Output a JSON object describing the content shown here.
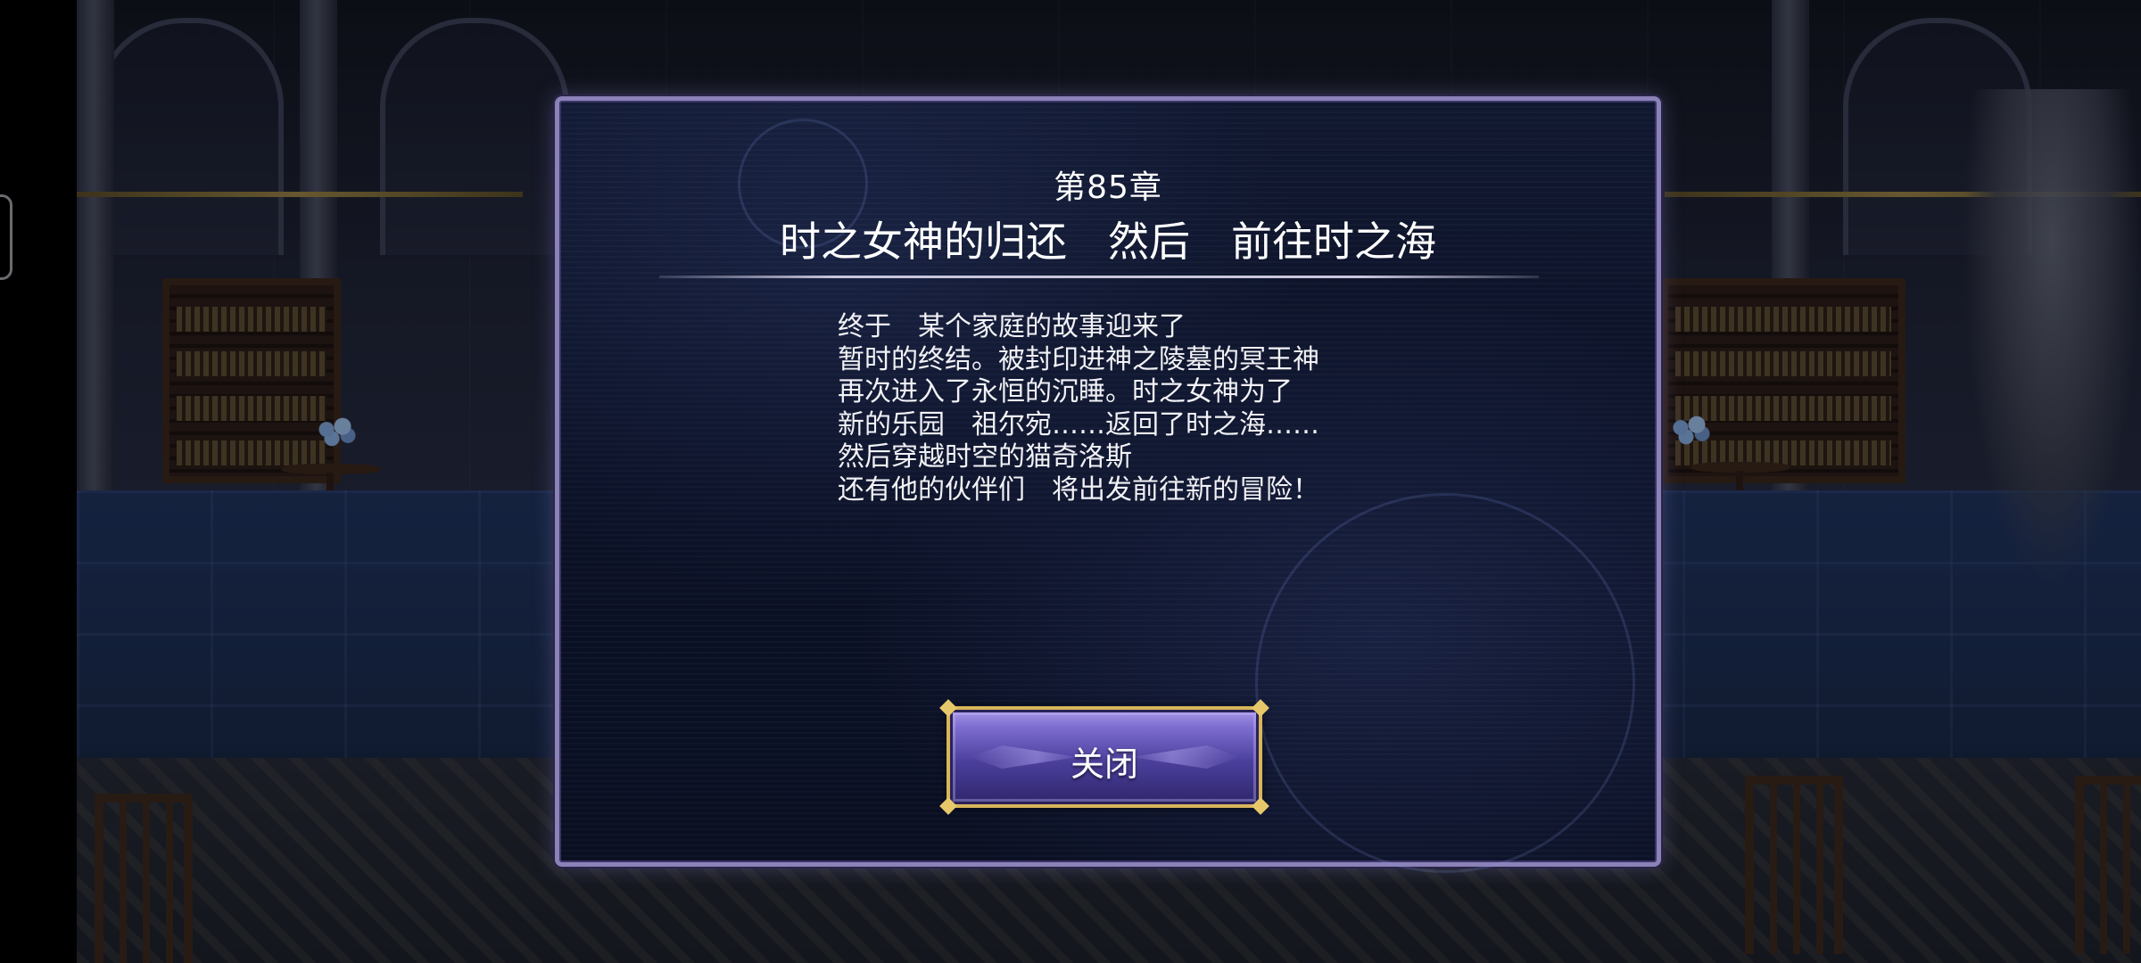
{
  "dialog": {
    "chapter": "第85章",
    "title": "时之女神的归还　然后　前往时之海",
    "story_lines": [
      "终于　某个家庭的故事迎来了",
      "暂时的终结。被封印进神之陵墓的冥王神",
      "再次进入了永恒的沉睡。时之女神为了",
      "新的乐园　祖尔宛……返回了时之海……",
      "然后穿越时空的猫奇洛斯",
      "还有他的伙伴们　将出发前往新的冒险！"
    ],
    "close_label": "关闭"
  },
  "colors": {
    "dialog_border": "#8b82b8",
    "dialog_bg": "#0b1126",
    "button_gold": "#d7b65a",
    "button_purple": "#4b3f9c",
    "text": "#ffffff"
  },
  "icons": {
    "system_handle": "side-handle-icon"
  }
}
